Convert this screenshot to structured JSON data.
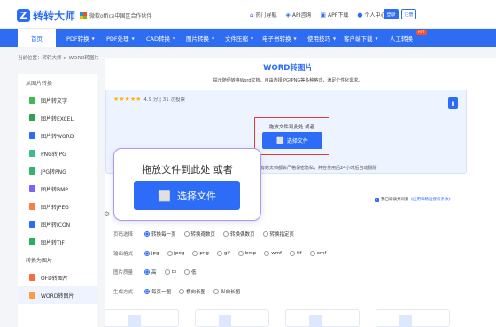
{
  "header": {
    "logo_mark": "Z",
    "logo_text": "转转大师",
    "partner_text": "微软office中国区合作伙伴",
    "links": [
      {
        "icon": "home-icon",
        "glyph": "⌂",
        "label": "热门导航"
      },
      {
        "icon": "api-icon",
        "glyph": "◈",
        "label": "API咨询"
      },
      {
        "icon": "app-icon",
        "glyph": "▣",
        "label": "APP下载"
      },
      {
        "icon": "user-icon",
        "glyph": "●",
        "label": "个人中心"
      }
    ],
    "login_label": "登录",
    "register_label": "注册"
  },
  "nav": {
    "items": [
      {
        "label": "首页",
        "arrow": ""
      },
      {
        "label": "PDF转换",
        "arrow": "▼"
      },
      {
        "label": "PDF处理",
        "arrow": "▼"
      },
      {
        "label": "CAD转换",
        "arrow": "▼"
      },
      {
        "label": "图片转换",
        "arrow": "▼"
      },
      {
        "label": "文件压缩",
        "arrow": "▼"
      },
      {
        "label": "电子书转换",
        "arrow": "▼"
      },
      {
        "label": "使用技巧",
        "arrow": "▼"
      },
      {
        "label": "客户端下载",
        "arrow": "▼"
      },
      {
        "label": "人工转换",
        "arrow": ""
      }
    ],
    "hot_badge": "HOT"
  },
  "breadcrumb": "当前位置：转转大师 > WORD转图片",
  "sidebar": {
    "group1": "从图片转换",
    "items1": [
      {
        "label": "图片转文字",
        "color": "#3fb950"
      },
      {
        "label": "图片转EXCEL",
        "color": "#2da44e"
      },
      {
        "label": "图片转WORD",
        "color": "#2c6cf6"
      },
      {
        "label": "PNG转JPG",
        "color": "#34c08a"
      },
      {
        "label": "JPG转PNG",
        "color": "#2fb56f"
      },
      {
        "label": "图片转BMP",
        "color": "#7b61ff"
      },
      {
        "label": "图片转JPEG",
        "color": "#ff7a45"
      },
      {
        "label": "图片转ICON",
        "color": "#2c6cf6"
      },
      {
        "label": "图片转TIF",
        "color": "#27ae60"
      }
    ],
    "group2": "转换为图片",
    "items2": [
      {
        "label": "OFD转图片",
        "color": "#ff6a3d"
      },
      {
        "label": "WORD转图片",
        "color": "#ff9a3d"
      }
    ]
  },
  "main": {
    "title": "WORD转图片",
    "subtitle": "提示随便转换Word文档，自由选择JPG\\PNG等多种格式，满足个性化需求。",
    "rating_stars": "★★★★★",
    "rating_text": "4.9 分 | 31 次投票",
    "corner_icon": "▮",
    "drop_hint": "拖放文件到此处 或者",
    "select_label": "选择文件",
    "privacy": "有的文档都会严格保密隐私，并在使用后24小时后自动删除",
    "zoom_hint": "拖放文件到此处 或者",
    "zoom_select_label": "选择文件",
    "file_icon": "⬜",
    "agree_text": "我已阅读并同意",
    "agree_link": "《应用和精准授权条款》",
    "gear_icon": "⚙"
  },
  "options": [
    {
      "label": "页码选择",
      "choices": [
        "转换每一页",
        "转换奇数页",
        "转换偶数页",
        "转换指定页"
      ],
      "selected": 0
    },
    {
      "label": "输出格式",
      "choices": [
        "jpg",
        "jpeg",
        "png",
        "gif",
        "bmp",
        "wmf",
        "tif",
        "emf"
      ],
      "selected": 0
    },
    {
      "label": "图片质量",
      "choices": [
        "高",
        "中",
        "低"
      ],
      "selected": 0
    },
    {
      "label": "生成方式",
      "choices": [
        "每页一图",
        "横向长图",
        "纵向长图"
      ],
      "selected": 0
    }
  ],
  "colors": {
    "brand": "#2c6cf6",
    "highlight": "#e23b3b",
    "popup_border": "#a99af0"
  }
}
